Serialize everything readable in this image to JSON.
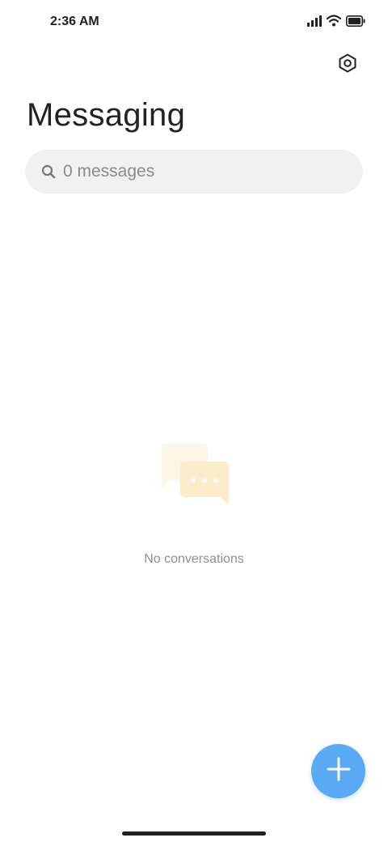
{
  "status_bar": {
    "time": "2:36 AM",
    "icons": [
      "signal-icon",
      "wifi-icon",
      "battery-icon"
    ]
  },
  "header": {
    "settings_icon": "settings-gear-icon"
  },
  "page": {
    "title": "Messaging"
  },
  "search": {
    "placeholder": "0 messages",
    "icon": "search-icon"
  },
  "empty_state": {
    "illustration": "chat-bubbles-icon",
    "message": "No conversations"
  },
  "fab": {
    "icon": "plus-icon",
    "color": "#5aa9f5"
  },
  "colors": {
    "accent": "#5aa9f5",
    "illustration_light": "#fdf6e6",
    "illustration_dark": "#fdeccc"
  }
}
